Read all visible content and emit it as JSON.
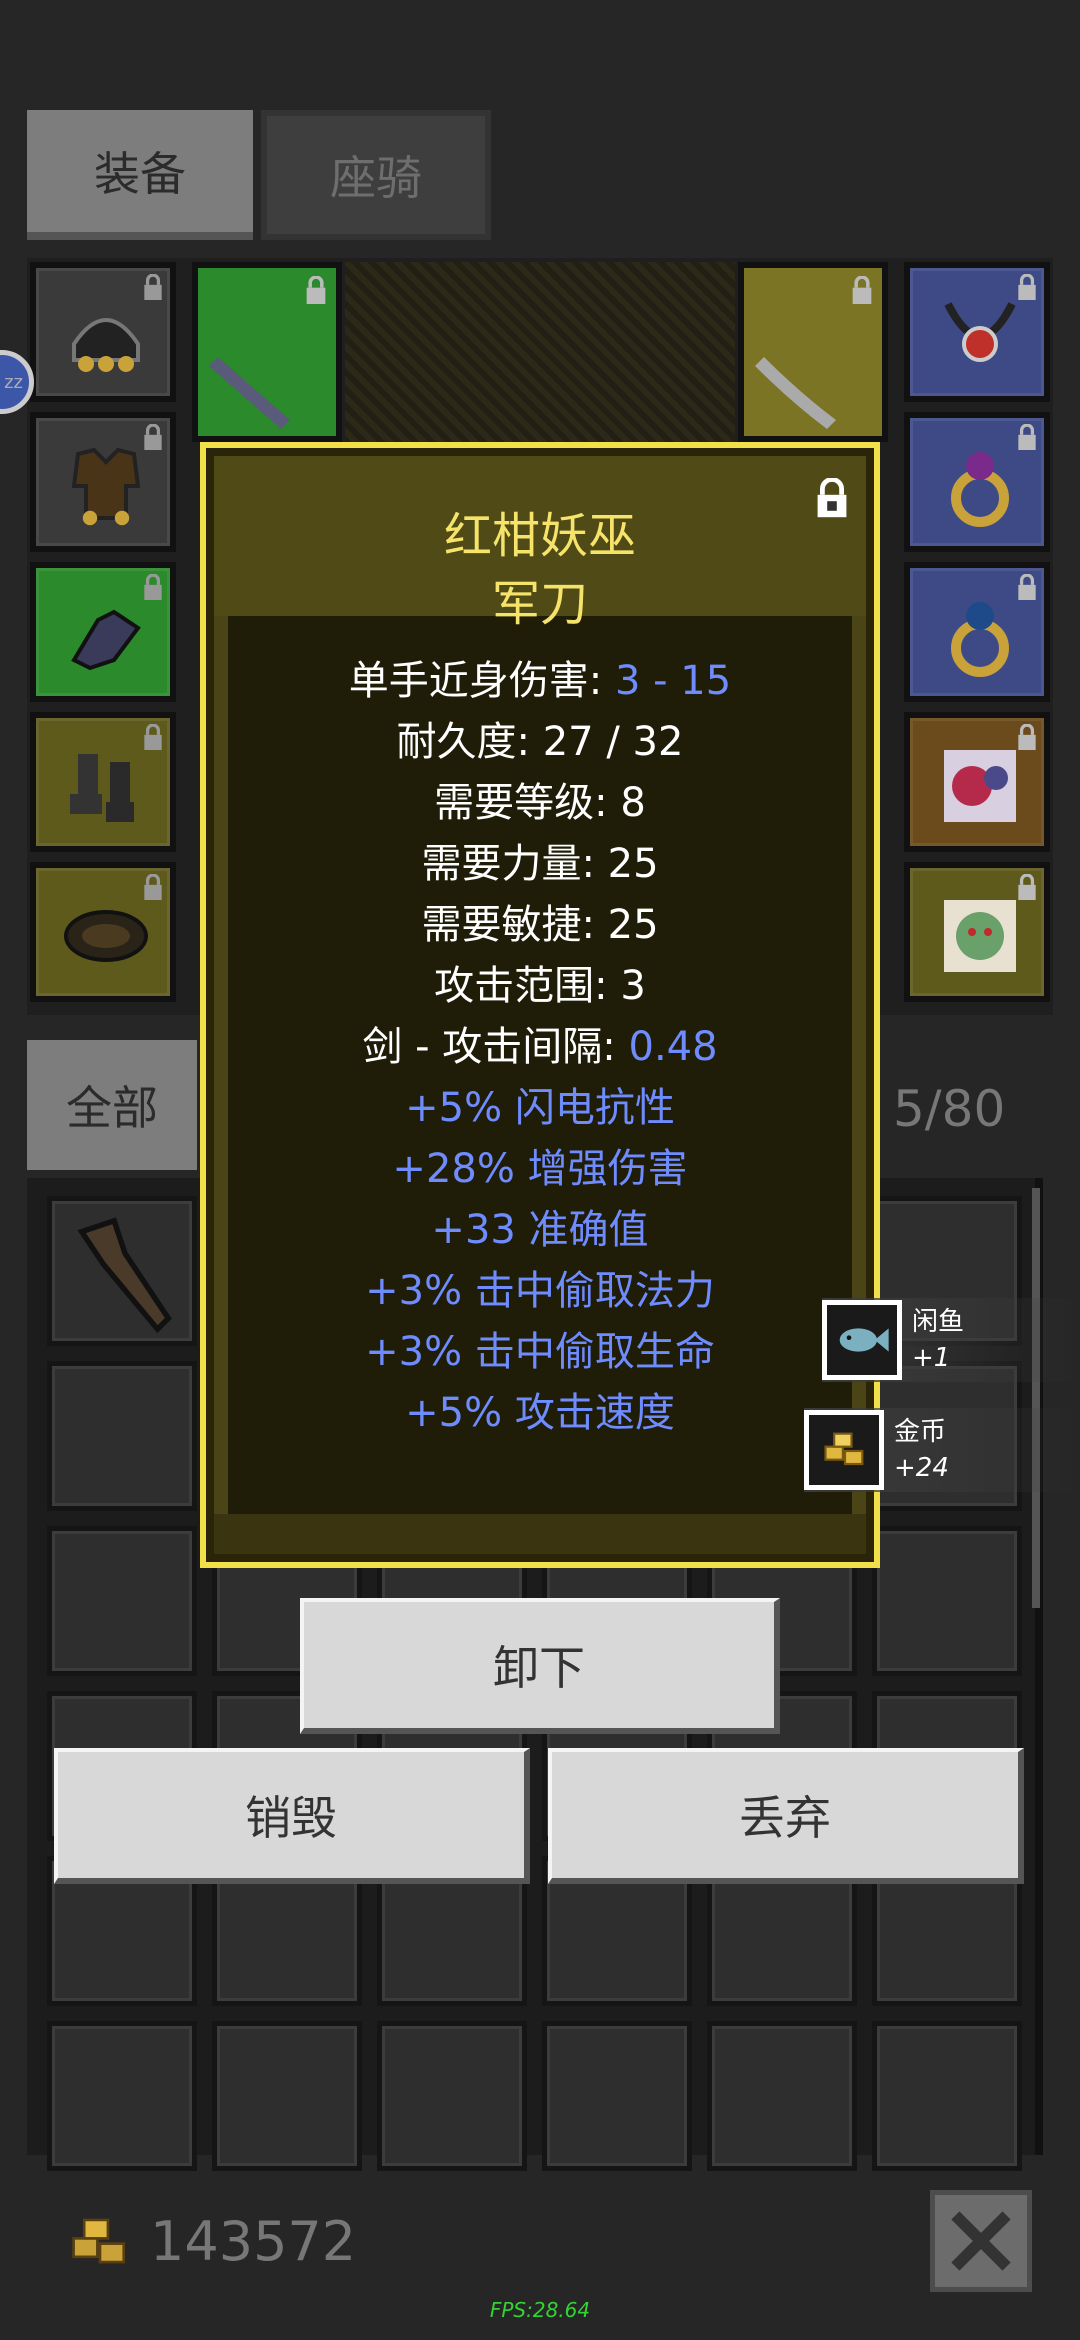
{
  "tabs": {
    "equipment": "装备",
    "mount": "座骑"
  },
  "side_badge": "zz",
  "item": {
    "name": "红柑妖巫",
    "type": "军刀",
    "stats": [
      {
        "label": "单手近身伤害: ",
        "value": "3 - 15"
      },
      {
        "label": "耐久度: 27 / 32",
        "value": ""
      },
      {
        "label": "需要等级: 8",
        "value": ""
      },
      {
        "label": "需要力量: 25",
        "value": ""
      },
      {
        "label": "需要敏捷: 25",
        "value": ""
      },
      {
        "label": "攻击范围: 3",
        "value": ""
      },
      {
        "label": "剑 - 攻击间隔: ",
        "value": "0.48"
      }
    ],
    "affixes": [
      "+5% 闪电抗性",
      "+28% 增强伤害",
      "+33 准确值",
      "+3% 击中偷取法力",
      "+3% 击中偷取生命",
      "+5% 攻击速度"
    ]
  },
  "actions": {
    "unequip": "卸下",
    "destroy": "销毁",
    "discard": "丢弃"
  },
  "filter": {
    "all": "全部"
  },
  "bag": {
    "count": "5/80"
  },
  "loot": [
    {
      "name": "闲鱼",
      "count": "+1",
      "icon": "fish-icon"
    },
    {
      "name": "金币",
      "count": "+24",
      "icon": "gold-coins-icon"
    }
  ],
  "gold": {
    "amount": "143572",
    "icon": "gold-coins-icon"
  },
  "fps": "FPS:28.64",
  "colors": {
    "title": "#f5e36a",
    "affix": "#6f8cff",
    "popup_border": "#f2e04a"
  }
}
